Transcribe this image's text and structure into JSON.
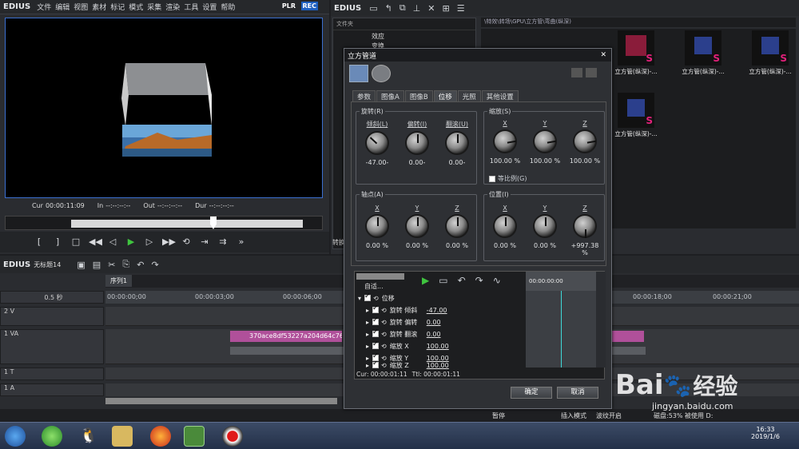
{
  "player": {
    "logo": "EDIUS",
    "menu": [
      "文件",
      "编辑",
      "视图",
      "素材",
      "标记",
      "模式",
      "采集",
      "渲染",
      "工具",
      "设置",
      "帮助"
    ],
    "plr": "PLR",
    "rec": "REC",
    "timecodes": {
      "cur_label": "Cur",
      "cur": "00:00:11:09",
      "in_label": "In",
      "in": "--:--:--:--",
      "out_label": "Out",
      "out": "--:--:--:--",
      "dur_label": "Dur",
      "dur": "--:--:--:--"
    }
  },
  "bin": {
    "logo": "EDIUS",
    "folder_header": "文件夹",
    "tree": [
      "效应",
      "变换"
    ],
    "path": "\\特效\\转场\\GPU\\立方管\\弯曲(纵深)",
    "clips": [
      {
        "label": "立方管(纵深)-..."
      },
      {
        "label": "立方管(纵深)-..."
      },
      {
        "label": "立方管(纵深)-..."
      },
      {
        "label": "立方管(纵深)-..."
      }
    ],
    "side_text": "转换"
  },
  "timeline": {
    "logo": "EDIUS",
    "project": "无标题14",
    "sequence": "序列1",
    "zoom": "0.5 秒",
    "ruler": [
      "00:00:00;00",
      "00:00:03;00",
      "00:00:06;00",
      "00:00:18;00",
      "00:00:21;00"
    ],
    "tracks": [
      {
        "name": "2 V"
      },
      {
        "name": "1 VA"
      },
      {
        "name": "1 T"
      },
      {
        "name": "1 A"
      }
    ],
    "clip_name": "370ace8df53227a204d64c76"
  },
  "status": {
    "pause": "暂停",
    "insert": "插入模式",
    "ripple": "波纹开启",
    "disk": "磁盘:53% 被使用 D:"
  },
  "taskbar": {
    "time": "16:33",
    "date": "2019/1/6"
  },
  "dialog": {
    "title": "立方管道",
    "close": "✕",
    "tabs": [
      "参数",
      "图像A",
      "图像B",
      "位移",
      "光照",
      "其他设置"
    ],
    "rotation": {
      "title": "旋转(R)",
      "knobs": [
        {
          "label": "倾斜(L)",
          "value": "-47.00-"
        },
        {
          "label": "偏转(I)",
          "value": "0.00-"
        },
        {
          "label": "翻滚(U)",
          "value": "0.00-"
        }
      ]
    },
    "scale": {
      "title": "缩放(S)",
      "knobs": [
        {
          "label": "X",
          "value": "100.00 %"
        },
        {
          "label": "Y",
          "value": "100.00 %"
        },
        {
          "label": "Z",
          "value": "100.00 %"
        }
      ],
      "ratio": "等比例(G)"
    },
    "pivot": {
      "title": "轴点(A)",
      "knobs": [
        {
          "label": "X",
          "value": "0.00 %"
        },
        {
          "label": "Y",
          "value": "0.00 %"
        },
        {
          "label": "Z",
          "value": "0.00 %"
        }
      ]
    },
    "position": {
      "title": "位置(I)",
      "knobs": [
        {
          "label": "X",
          "value": "0.00 %"
        },
        {
          "label": "Y",
          "value": "0.00 %"
        },
        {
          "label": "Z",
          "value": "+997.38 %"
        }
      ]
    },
    "keyframe": {
      "preset": "自适...",
      "group": "位移",
      "tc": "00:00:00:00",
      "rows": [
        {
          "name": "旋转 倾斜",
          "value": "-47.00"
        },
        {
          "name": "旋转 偏转",
          "value": "0.00"
        },
        {
          "name": "旋转 翻滚",
          "value": "0.00"
        },
        {
          "name": "缩放 X",
          "value": "100.00"
        },
        {
          "name": "缩放 Y",
          "value": "100.00"
        },
        {
          "name": "缩放 Z",
          "value": "100.00"
        }
      ],
      "cur": "Cur: 00:00:01:11",
      "ttl": "Ttl: 00:00:01:11"
    },
    "ok": "确定",
    "cancel": "取消"
  },
  "watermark": {
    "brand": "Bai",
    "brand2": "经验",
    "site": "jingyan.baidu.com"
  },
  "colors": {
    "accent": "#1e5fc0",
    "green": "#3fc43f",
    "clip_pink": "#b0509a"
  }
}
